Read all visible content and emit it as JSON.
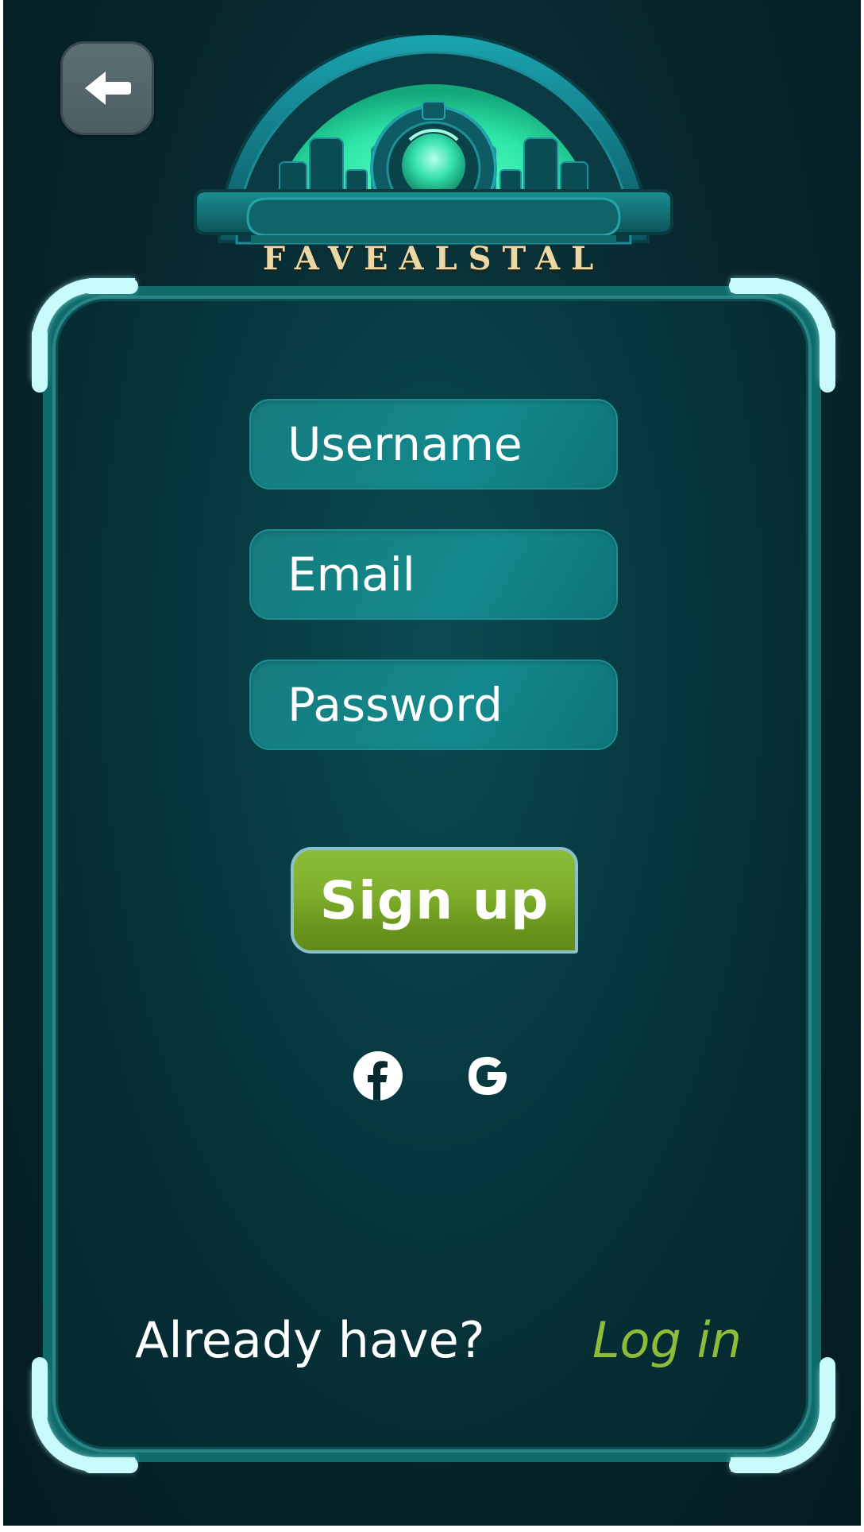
{
  "app": {
    "logo_text": "FAVEALSTAL"
  },
  "header": {
    "back_button_icon": "arrow-left-icon"
  },
  "form": {
    "username_placeholder": "Username",
    "email_placeholder": "Email",
    "password_placeholder": "Password",
    "username_value": "",
    "email_value": "",
    "password_value": "",
    "signup_label": "Sign up"
  },
  "social": {
    "facebook_icon": "facebook-icon",
    "google_icon": "google-icon"
  },
  "footer": {
    "prompt": "Already have?",
    "login_label": "Log in"
  },
  "colors": {
    "background": "#052a30",
    "panel_frame": "#0f6b6b",
    "corner_accent": "#c9fbfd",
    "input_fill": "#13898d",
    "signup_green": "#7eae2c",
    "login_link": "#8dbb3a",
    "logo_text": "#ead9a6"
  }
}
